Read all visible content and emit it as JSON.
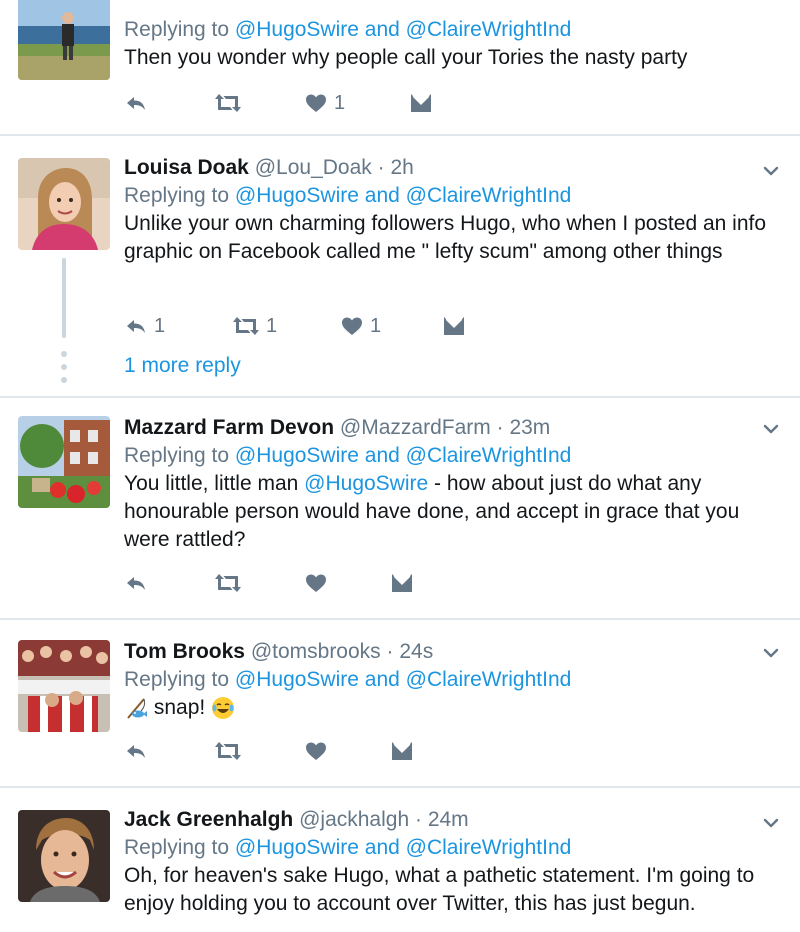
{
  "tweets": [
    {
      "reply_prefix": "Replying to",
      "reply_to": "@HugoSwire and @ClaireWrightInd",
      "text": "Then you wonder why people call your Tories the nasty party",
      "like_count": "1"
    },
    {
      "name": "Louisa Doak",
      "handle": "@Lou_Doak",
      "time": "2h",
      "reply_prefix": "Replying to",
      "reply_to": "@HugoSwire and @ClaireWrightInd",
      "text": "Unlike your own charming followers Hugo, who when I posted an info graphic on Facebook called me \" lefty scum\" among other things",
      "reply_count": "1",
      "retweet_count": "1",
      "like_count": "1",
      "more_replies": "1 more reply"
    },
    {
      "name": "Mazzard Farm Devon",
      "handle": "@MazzardFarm",
      "time": "23m",
      "reply_prefix": "Replying to",
      "reply_to": "@HugoSwire and @ClaireWrightInd",
      "text_before": "You little, little man ",
      "text_mention": "@HugoSwire",
      "text_after": " - how about just do what any honourable person would have done, and accept in grace that you were rattled?"
    },
    {
      "name": "Tom Brooks",
      "handle": "@tomsbrooks",
      "time": "24s",
      "reply_prefix": "Replying to",
      "reply_to": "@HugoSwire and @ClaireWrightInd",
      "text": "snap!"
    },
    {
      "name": "Jack Greenhalgh",
      "handle": "@jackhalgh",
      "time": "24m",
      "reply_prefix": "Replying to",
      "reply_to": "@HugoSwire and @ClaireWrightInd",
      "text": "Oh, for heaven's sake Hugo, what a pathetic statement. I'm going to enjoy holding you to account over Twitter, this has just begun."
    }
  ],
  "separator": "·",
  "icons": [
    "reply-icon",
    "retweet-icon",
    "like-icon",
    "direct-message-icon",
    "chevron-down-icon",
    "fishing-pole-emoji",
    "crying-laughing-emoji"
  ],
  "colors": {
    "link": "#1b95e0",
    "secondary": "#657786",
    "text": "#14171a",
    "border": "#e1e8ed"
  }
}
